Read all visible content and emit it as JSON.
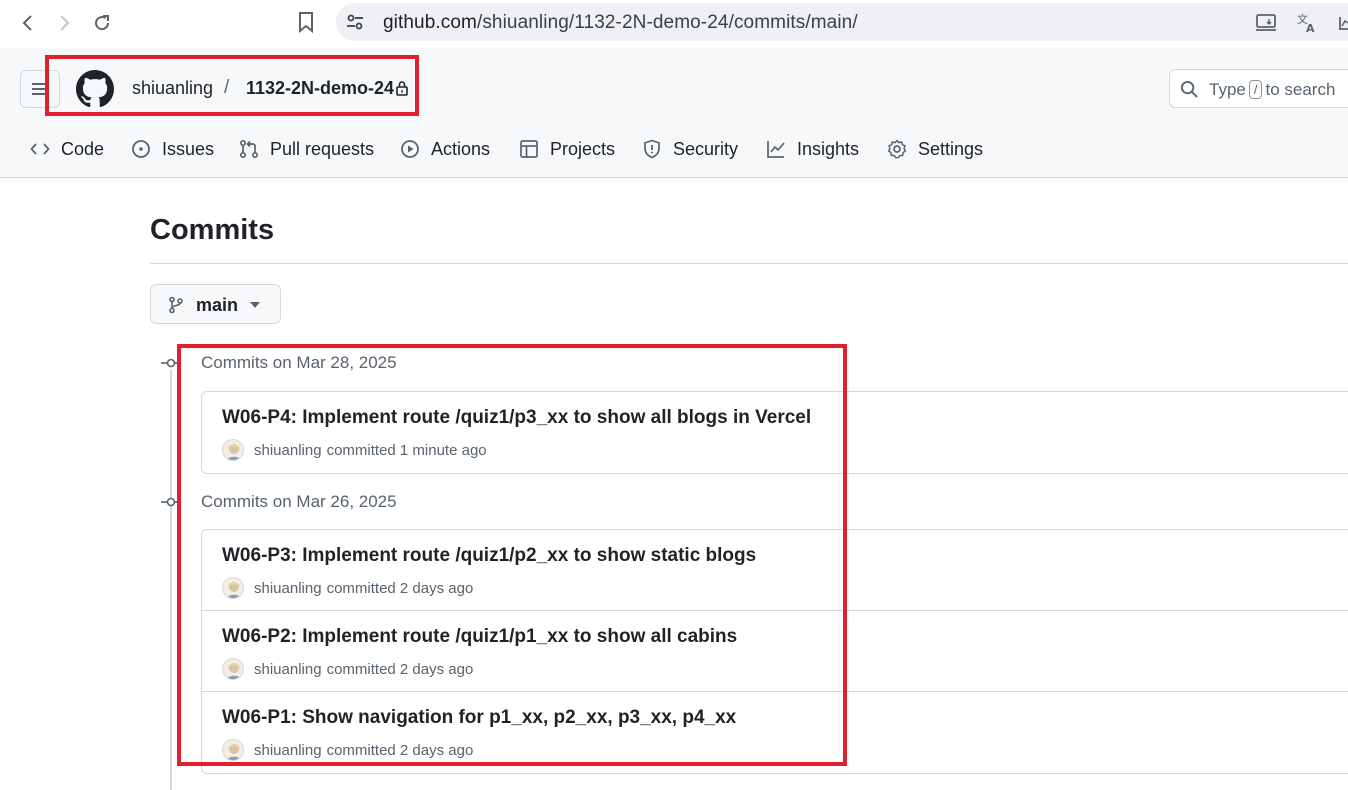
{
  "browser": {
    "url_host": "github.com",
    "url_path": "/shiuanling/1132-2N-demo-24/commits/main/"
  },
  "header": {
    "owner": "shiuanling",
    "separator": "/",
    "repo": "1132-2N-demo-24",
    "search_prefix": "Type",
    "search_key": "/",
    "search_suffix": "to search"
  },
  "tabs": [
    {
      "label": "Code",
      "icon": "code-icon"
    },
    {
      "label": "Issues",
      "icon": "issue-icon"
    },
    {
      "label": "Pull requests",
      "icon": "pull-request-icon"
    },
    {
      "label": "Actions",
      "icon": "play-icon"
    },
    {
      "label": "Projects",
      "icon": "table-icon"
    },
    {
      "label": "Security",
      "icon": "shield-icon"
    },
    {
      "label": "Insights",
      "icon": "graph-icon"
    },
    {
      "label": "Settings",
      "icon": "gear-icon"
    }
  ],
  "page": {
    "title": "Commits",
    "branch": "main"
  },
  "groups": [
    {
      "heading": "Commits on Mar 28, 2025",
      "commits": [
        {
          "message": "W06-P4: Implement route /quiz1/p3_xx to show all blogs in Vercel",
          "author": "shiuanling",
          "meta": "committed 1 minute ago"
        }
      ]
    },
    {
      "heading": "Commits on Mar 26, 2025",
      "commits": [
        {
          "message": "W06-P3: Implement route /quiz1/p2_xx to show static blogs",
          "author": "shiuanling",
          "meta": "committed 2 days ago"
        },
        {
          "message": "W06-P2: Implement route /quiz1/p1_xx to show all cabins",
          "author": "shiuanling",
          "meta": "committed 2 days ago"
        },
        {
          "message": "W06-P1: Show navigation for p1_xx, p2_xx, p3_xx, p4_xx",
          "author": "shiuanling",
          "meta": "committed 2 days ago"
        }
      ]
    }
  ],
  "colors": {
    "highlight_box": "#e0202e",
    "header_bg": "#f6f8fa",
    "border": "#d1d9e0"
  }
}
